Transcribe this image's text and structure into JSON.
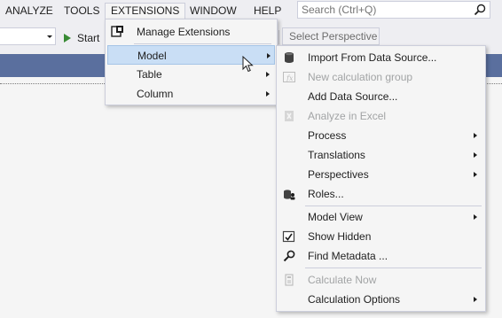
{
  "menubar": {
    "items": [
      {
        "label": "ANALYZE"
      },
      {
        "label": "TOOLS"
      },
      {
        "label": "EXTENSIONS"
      },
      {
        "label": "WINDOW"
      },
      {
        "label": "HELP"
      }
    ],
    "search_placeholder": "Search (Ctrl+Q)"
  },
  "toolbar": {
    "start_label": "Start",
    "perspective_label": "Select Perspective"
  },
  "extensions_menu": {
    "items": [
      {
        "label": "Manage Extensions",
        "icon": "manage-extensions-icon"
      },
      {
        "label": "Model",
        "submenu": true,
        "highlighted": true
      },
      {
        "label": "Table",
        "submenu": true
      },
      {
        "label": "Column",
        "submenu": true
      }
    ]
  },
  "model_menu": {
    "items": [
      {
        "label": "Import From Data Source...",
        "icon": "database-icon"
      },
      {
        "label": "New calculation group",
        "icon": "calculation-group-icon",
        "disabled": true
      },
      {
        "label": "Add Data Source..."
      },
      {
        "label": "Analyze in Excel",
        "icon": "excel-icon",
        "disabled": true
      },
      {
        "label": "Process",
        "submenu": true
      },
      {
        "label": "Translations",
        "submenu": true
      },
      {
        "label": "Perspectives",
        "submenu": true
      },
      {
        "label": "Roles...",
        "icon": "roles-icon"
      },
      {
        "label": "Model View",
        "submenu": true
      },
      {
        "label": "Show Hidden",
        "icon": "show-hidden-icon"
      },
      {
        "label": "Find Metadata ...",
        "icon": "find-metadata-icon"
      },
      {
        "label": "Calculate Now",
        "icon": "calculate-now-icon",
        "disabled": true
      },
      {
        "label": "Calculation Options",
        "submenu": true
      }
    ]
  },
  "colors": {
    "menu_background": "#f5f5f5",
    "highlight": "#c9def5",
    "document_strip": "#5a6f9e",
    "disabled_text": "#a2a4a5",
    "start_green": "#388a34"
  }
}
